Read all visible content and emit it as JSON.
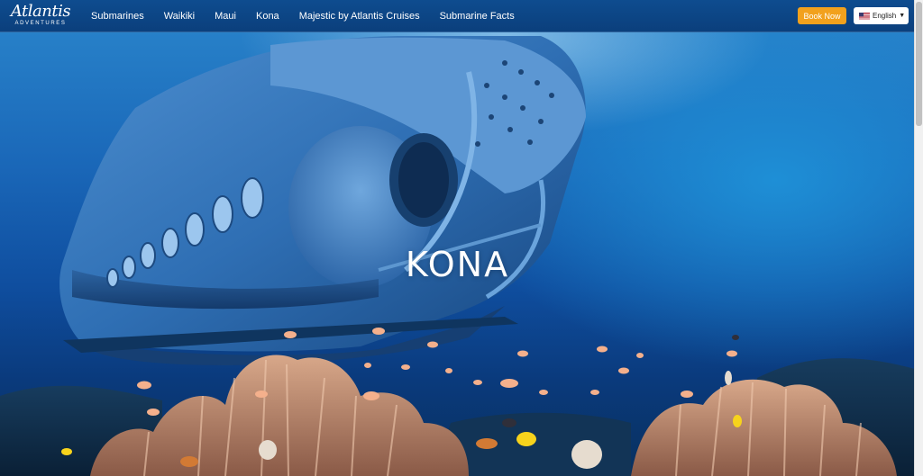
{
  "brand": {
    "name": "Atlantis",
    "tagline": "ADVENTURES"
  },
  "nav": {
    "links": [
      "Submarines",
      "Waikiki",
      "Maui",
      "Kona",
      "Majestic by Atlantis Cruises",
      "Submarine Facts"
    ],
    "book_label": "Book Now",
    "language_label": "English"
  },
  "hero": {
    "title": "KONA"
  },
  "colors": {
    "nav_bg": "#0e4c8f",
    "book_button": "#f2a11d",
    "ocean": "#1a67b8"
  }
}
